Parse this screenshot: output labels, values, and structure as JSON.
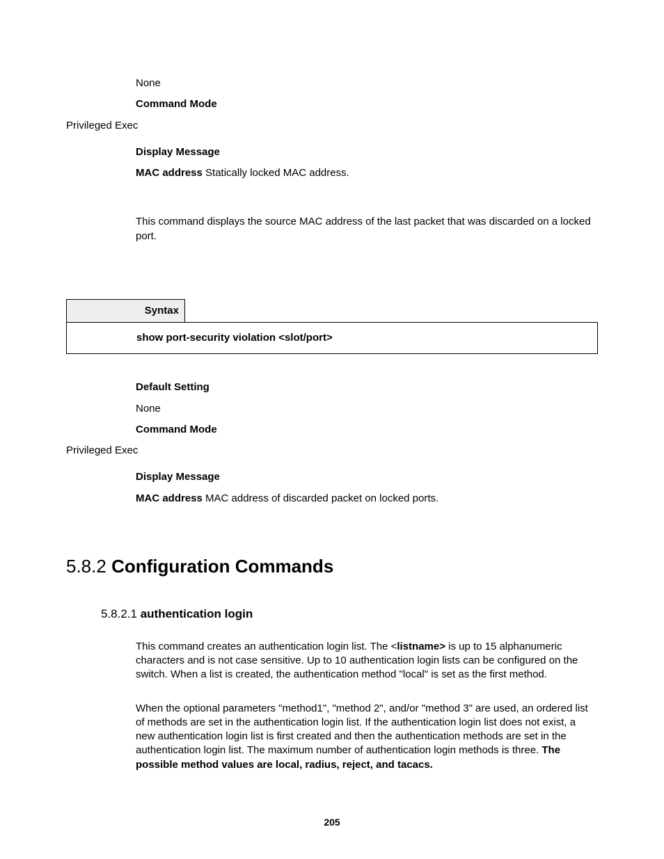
{
  "block1": {
    "none": "None",
    "cmd_mode_label": "Command Mode",
    "cmd_mode_value": "Privileged Exec",
    "disp_msg_label": "Display Message",
    "mac_label": "MAC address",
    "mac_text": " Statically locked MAC address.",
    "desc": "This command displays the source MAC address of the last packet that was discarded on a locked port."
  },
  "syntax": {
    "label": "Syntax",
    "command": "show port-security violation <slot/port>"
  },
  "block2": {
    "default_label": "Default Setting",
    "default_value": "None",
    "cmd_mode_label": "Command Mode",
    "cmd_mode_value": "Privileged Exec",
    "disp_msg_label": "Display Message",
    "mac_label": "MAC address",
    "mac_text": " MAC address of discarded packet on locked ports."
  },
  "heading": {
    "num": "5.8.2 ",
    "title": "Configuration Commands"
  },
  "subheading": {
    "num": "5.8.2.1 ",
    "title": "authentication login"
  },
  "auth": {
    "p1_a": "This command creates an authentication login list. The <",
    "p1_b": "listname>",
    "p1_c": " is up to 15 alphanumeric characters and is not case sensitive. Up to 10 authentication login lists can be configured on the switch. When a list is created, the authentication method \"local\" is set as the first method.",
    "p2_a": "When the optional parameters \"method1\", \"method 2\", and/or \"method 3\" are used, an ordered list of methods are set in the authentication login list. If the authentication login list does not exist, a new authentication login list is first created and then the authentication methods are set in the authentication login list. The maximum number of authentication login methods is three. ",
    "p2_b": "The possible method values are local, radius, reject, and tacacs."
  },
  "page_number": "205"
}
